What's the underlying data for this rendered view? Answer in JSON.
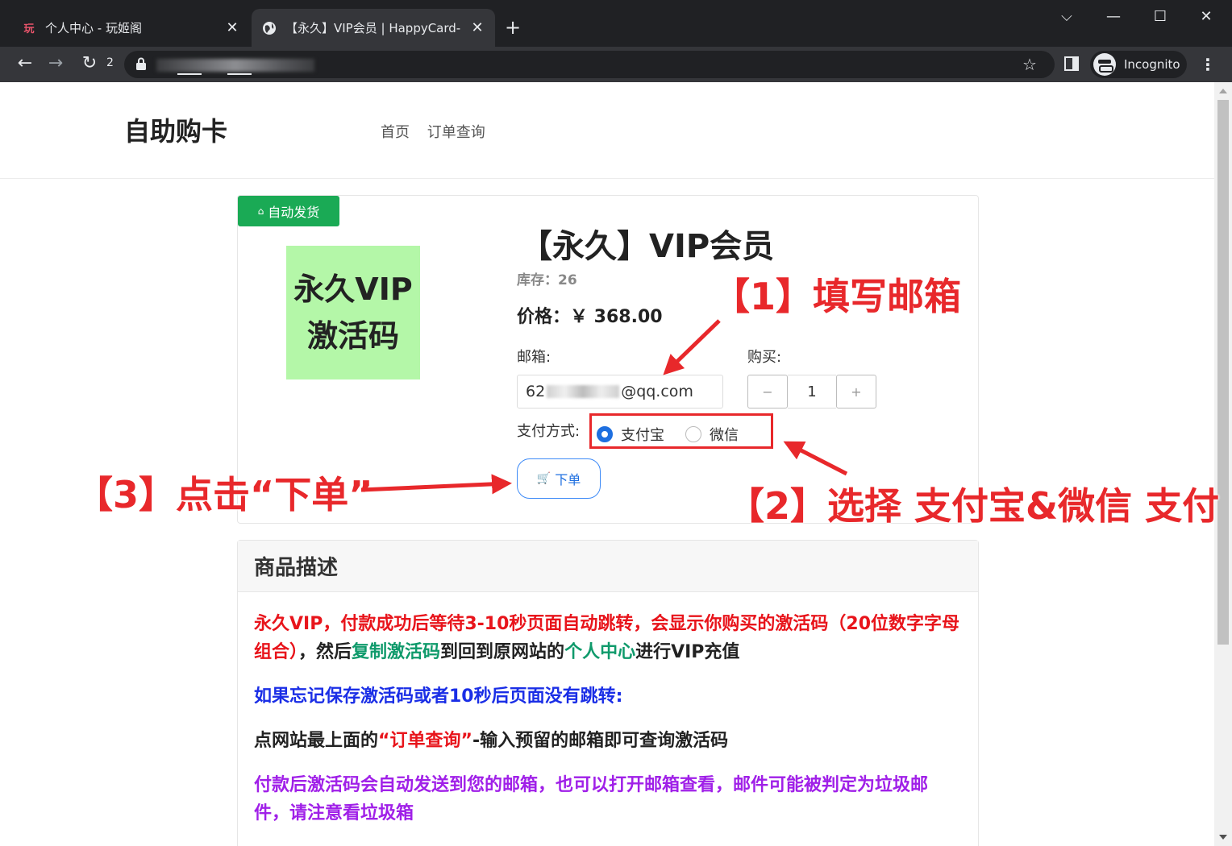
{
  "browser": {
    "tabs": [
      {
        "favicon": "玩",
        "title": "个人中心 - 玩姬阁",
        "active": false
      },
      {
        "favicon": "globe-icon",
        "title": "【永久】VIP会员 | HappyCard-",
        "active": true
      }
    ],
    "new_tab": "+",
    "reload_count": "2",
    "profile_label": "Incognito"
  },
  "site": {
    "brand": "自助购卡",
    "nav": [
      "首页",
      "订单查询"
    ]
  },
  "product": {
    "badge": "自动发货",
    "image_lines": [
      "永久VIP",
      "激活码"
    ],
    "title": "【永久】VIP会员",
    "stock": "库存：26",
    "price": "价格：￥ 368.00",
    "email_label": "邮箱:",
    "email_prefix": "62",
    "email_suffix": "@qq.com",
    "buy_label": "购买:",
    "minus": "−",
    "quantity": "1",
    "plus": "+",
    "pay_label": "支付方式:",
    "pay_options": [
      {
        "label": "支付宝",
        "selected": true
      },
      {
        "label": "微信",
        "selected": false
      }
    ],
    "order_button": "下单"
  },
  "description": {
    "heading": "商品描述",
    "p1": {
      "a": "永久VIP，付款成功后等待3-10秒页面自动跳转，会显示你购买的激活码（20位数字字母组合）",
      "b": "，然后",
      "c": "复制激活码",
      "d": "到回到原网站的",
      "e": "个人中心",
      "f": "进行VIP充值"
    },
    "p2": "如果忘记保存激活码或者10秒后页面没有跳转:",
    "p3": {
      "a": "点网站最上面的",
      "b": "“订单查询”",
      "c": "-输入预留的邮箱即可查询激活码"
    },
    "p4": "付款后激活码会自动发送到您的邮箱，也可以打开邮箱查看，邮件可能被判定为垃圾邮件，请注意看垃圾箱"
  },
  "annotations": {
    "step1": "【1】填写邮箱",
    "step2": "【2】选择 支付宝&微信 支付",
    "step3": "【3】点击“下单”"
  },
  "colors": {
    "annotation": "#e8282b",
    "badge": "#1aaa55",
    "accent": "#1e6fe0"
  }
}
